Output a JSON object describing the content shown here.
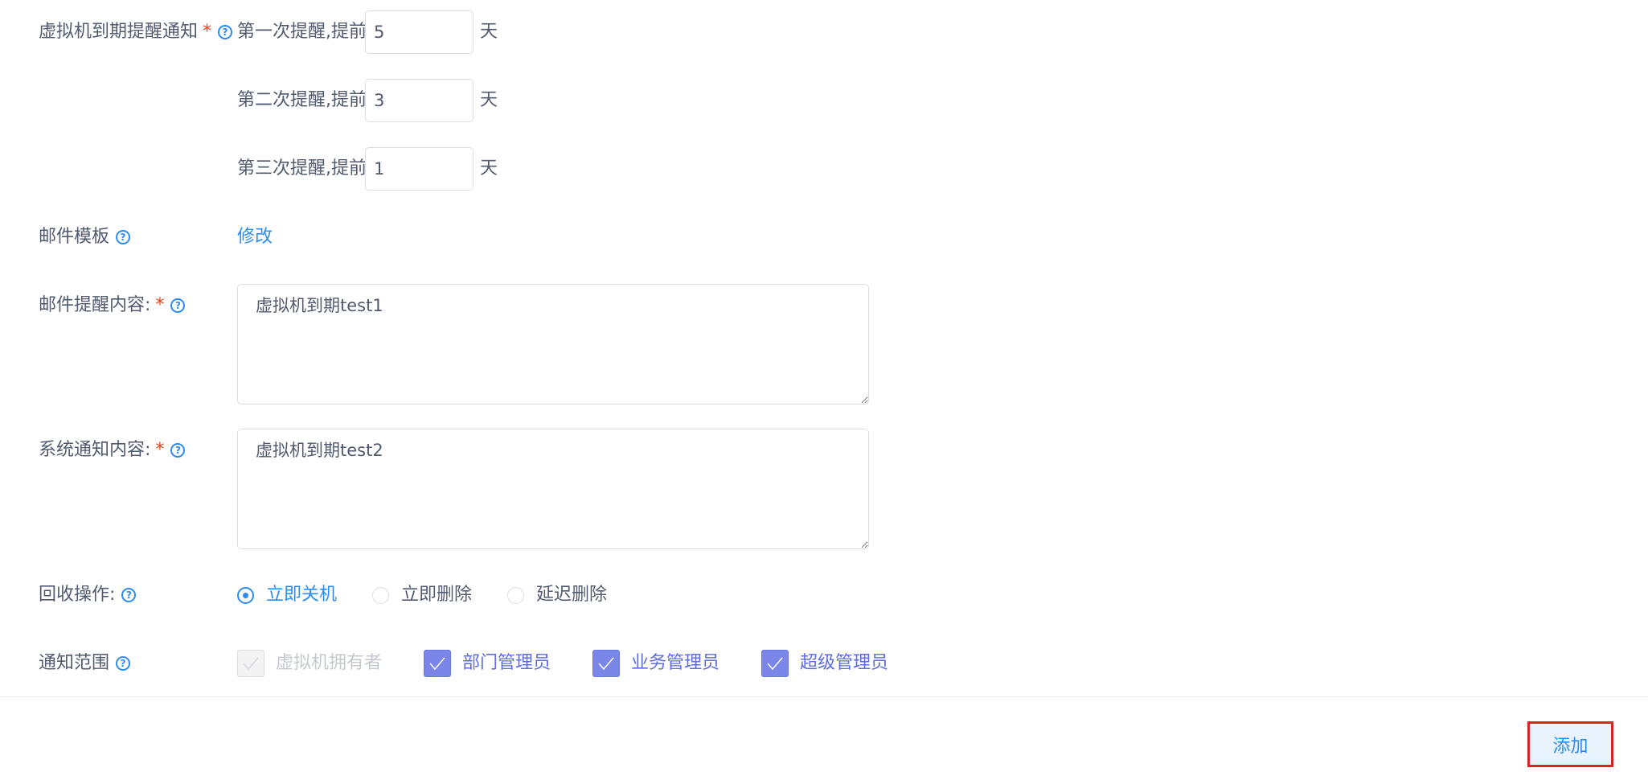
{
  "expiry_notice": {
    "label": "虚拟机到期提醒通知",
    "required_mark": "*",
    "reminders": [
      {
        "prefix": "第一次提醒,提前",
        "value": "5",
        "unit": "天"
      },
      {
        "prefix": "第二次提醒,提前",
        "value": "3",
        "unit": "天"
      },
      {
        "prefix": "第三次提醒,提前",
        "value": "1",
        "unit": "天"
      }
    ]
  },
  "mail_template": {
    "label": "邮件模板",
    "action": "修改"
  },
  "mail_content": {
    "label": "邮件提醒内容:",
    "required_mark": "*",
    "value": "虚拟机到期test1"
  },
  "system_content": {
    "label": "系统通知内容:",
    "required_mark": "*",
    "value": "虚拟机到期test2"
  },
  "recycle": {
    "label": "回收操作:",
    "options": [
      "立即关机",
      "立即删除",
      "延迟删除"
    ],
    "selected": "立即关机"
  },
  "notify_scope": {
    "label": "通知范围",
    "options": [
      {
        "label": "虚拟机拥有者",
        "checked": true,
        "disabled": true
      },
      {
        "label": "部门管理员",
        "checked": true,
        "disabled": false
      },
      {
        "label": "业务管理员",
        "checked": true,
        "disabled": false
      },
      {
        "label": "超级管理员",
        "checked": true,
        "disabled": false
      }
    ]
  },
  "footer": {
    "add_label": "添加"
  },
  "icons": {
    "help": "question-circle-icon",
    "check": "checkmark-icon"
  },
  "colors": {
    "primary": "#2d8cf0",
    "required": "#ed4014",
    "checkbox_checked": "#7a87e8",
    "highlight_border": "#e02020"
  }
}
